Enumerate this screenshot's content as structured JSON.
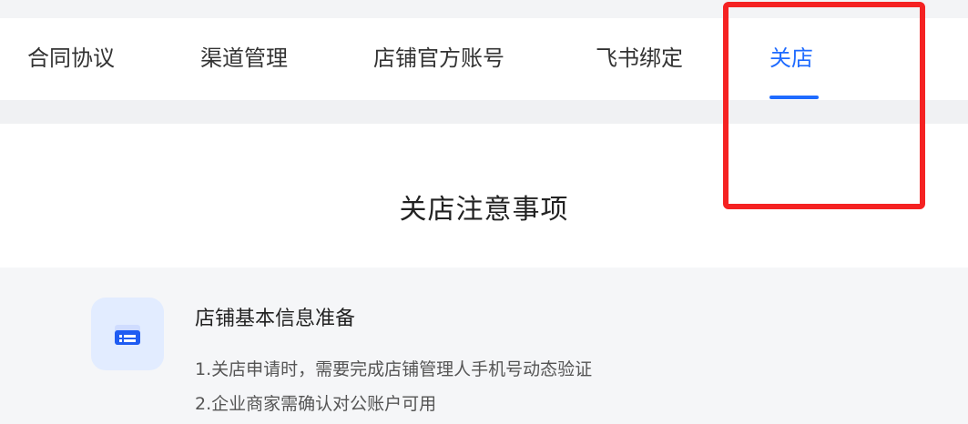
{
  "tabs": [
    {
      "label": "合同协议",
      "active": false
    },
    {
      "label": "渠道管理",
      "active": false
    },
    {
      "label": "店铺官方账号",
      "active": false
    },
    {
      "label": "飞书绑定",
      "active": false
    },
    {
      "label": "关店",
      "active": true
    }
  ],
  "main": {
    "section_title": "关店注意事项",
    "card": {
      "icon": "shop-icon",
      "title": "店铺基本信息准备",
      "lines": [
        "1.关店申请时，需要完成店铺管理人手机号动态验证",
        "2.企业商家需确认对公账户可用"
      ]
    }
  },
  "colors": {
    "accent": "#1f6bff",
    "highlight": "#f52222",
    "icon_bg": "#e2ecff"
  }
}
